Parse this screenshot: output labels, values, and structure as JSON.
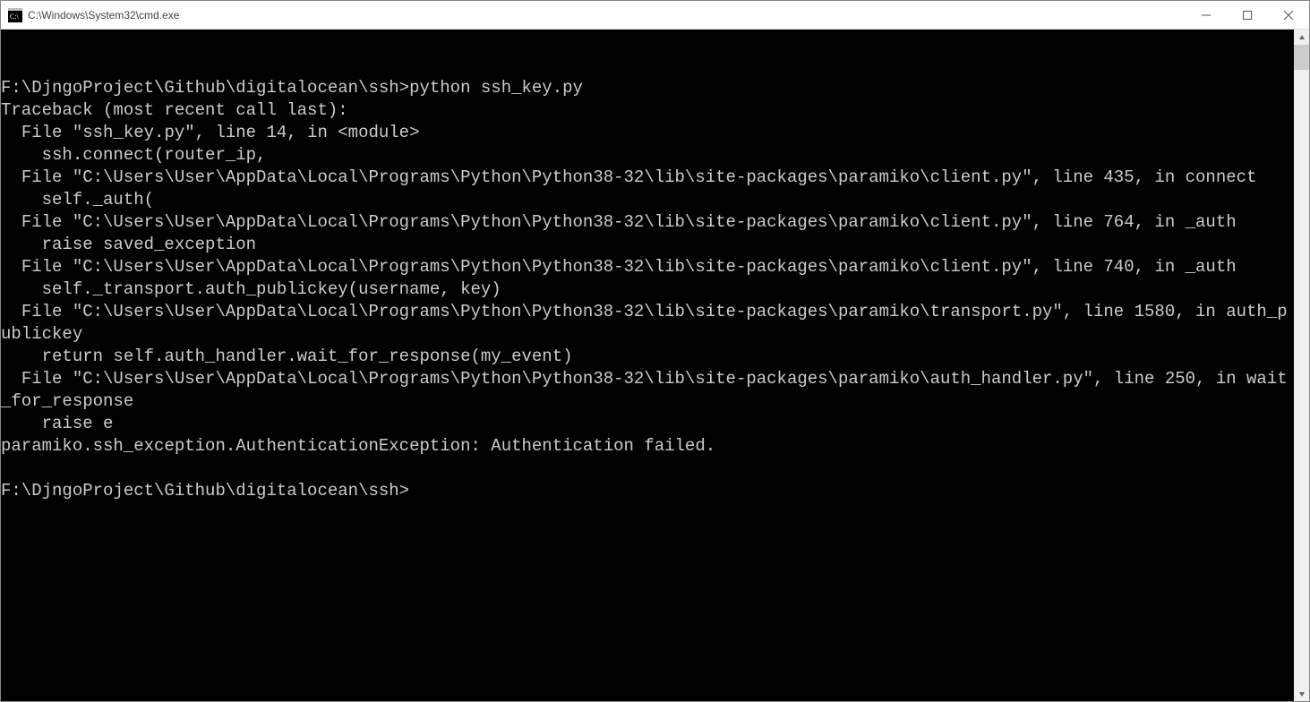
{
  "window": {
    "title": "C:\\Windows\\System32\\cmd.exe"
  },
  "terminal": {
    "lines": [
      "",
      "F:\\DjngoProject\\Github\\digitalocean\\ssh>python ssh_key.py",
      "Traceback (most recent call last):",
      "  File \"ssh_key.py\", line 14, in <module>",
      "    ssh.connect(router_ip,",
      "  File \"C:\\Users\\User\\AppData\\Local\\Programs\\Python\\Python38-32\\lib\\site-packages\\paramiko\\client.py\", line 435, in connect",
      "    self._auth(",
      "  File \"C:\\Users\\User\\AppData\\Local\\Programs\\Python\\Python38-32\\lib\\site-packages\\paramiko\\client.py\", line 764, in _auth",
      "    raise saved_exception",
      "  File \"C:\\Users\\User\\AppData\\Local\\Programs\\Python\\Python38-32\\lib\\site-packages\\paramiko\\client.py\", line 740, in _auth",
      "    self._transport.auth_publickey(username, key)",
      "  File \"C:\\Users\\User\\AppData\\Local\\Programs\\Python\\Python38-32\\lib\\site-packages\\paramiko\\transport.py\", line 1580, in auth_publickey",
      "    return self.auth_handler.wait_for_response(my_event)",
      "  File \"C:\\Users\\User\\AppData\\Local\\Programs\\Python\\Python38-32\\lib\\site-packages\\paramiko\\auth_handler.py\", line 250, in wait_for_response",
      "    raise e",
      "paramiko.ssh_exception.AuthenticationException: Authentication failed.",
      "",
      "F:\\DjngoProject\\Github\\digitalocean\\ssh>"
    ]
  }
}
